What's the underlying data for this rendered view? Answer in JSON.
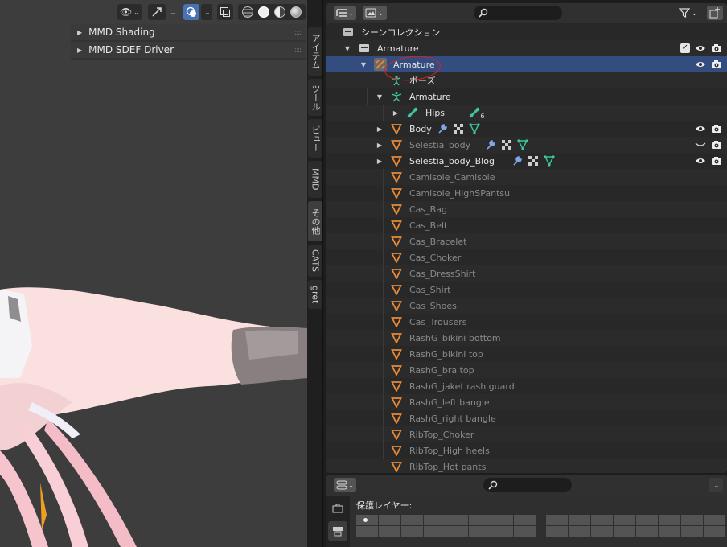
{
  "viewport": {
    "panels": [
      {
        "label": "MMD Shading"
      },
      {
        "label": "MMD SDEF Driver"
      }
    ]
  },
  "sidebar_tabs": [
    {
      "label": "アイテム",
      "active": false
    },
    {
      "label": "ツール",
      "active": false
    },
    {
      "label": "ビュー",
      "active": false
    },
    {
      "label": "MMD",
      "active": false
    },
    {
      "label": "その他",
      "active": true
    },
    {
      "label": "CATS",
      "active": false
    },
    {
      "label": "gret",
      "active": false
    }
  ],
  "outliner": {
    "search": {
      "value": "",
      "placeholder": ""
    },
    "rows": [
      {
        "label": "シーンコレクション",
        "icon": "scene-collection-icon",
        "expander": "",
        "dim": false
      },
      {
        "label": "Armature",
        "icon": "collection-icon",
        "expander": "▼",
        "dim": false,
        "checked": true
      },
      {
        "label": "Armature",
        "icon": "armature-object-icon",
        "expander": "▼",
        "dim": false,
        "selected": true
      },
      {
        "label": "ポーズ",
        "icon": "pose-icon",
        "expander": "",
        "dim": false
      },
      {
        "label": "Armature",
        "icon": "armature-data-icon",
        "expander": "▼",
        "dim": false
      },
      {
        "label": "Hips",
        "icon": "bone-icon",
        "expander": "▶",
        "dim": false,
        "badge": "6"
      },
      {
        "label": "Body",
        "icon": "mesh-icon",
        "expander": "▶",
        "dim": false,
        "mods": true
      },
      {
        "label": "Selestia_body",
        "icon": "mesh-icon",
        "expander": "▶",
        "dim": true,
        "mods": true,
        "hidden": true
      },
      {
        "label": "Selestia_body_Blog",
        "icon": "mesh-icon",
        "expander": "▶",
        "dim": false,
        "mods": true
      },
      {
        "label": "Camisole_Camisole",
        "icon": "mesh-icon",
        "expander": "",
        "dim": true
      },
      {
        "label": "Camisole_HighSPantsu",
        "icon": "mesh-icon",
        "expander": "",
        "dim": true
      },
      {
        "label": "Cas_Bag",
        "icon": "mesh-icon",
        "expander": "",
        "dim": true
      },
      {
        "label": "Cas_Belt",
        "icon": "mesh-icon",
        "expander": "",
        "dim": true
      },
      {
        "label": "Cas_Bracelet",
        "icon": "mesh-icon",
        "expander": "",
        "dim": true
      },
      {
        "label": "Cas_Choker",
        "icon": "mesh-icon",
        "expander": "",
        "dim": true
      },
      {
        "label": "Cas_DressShirt",
        "icon": "mesh-icon",
        "expander": "",
        "dim": true
      },
      {
        "label": "Cas_Shirt",
        "icon": "mesh-icon",
        "expander": "",
        "dim": true
      },
      {
        "label": "Cas_Shoes",
        "icon": "mesh-icon",
        "expander": "",
        "dim": true
      },
      {
        "label": "Cas_Trousers",
        "icon": "mesh-icon",
        "expander": "",
        "dim": true
      },
      {
        "label": "RashG_bikini bottom",
        "icon": "mesh-icon",
        "expander": "",
        "dim": true
      },
      {
        "label": "RashG_bikini top",
        "icon": "mesh-icon",
        "expander": "",
        "dim": true
      },
      {
        "label": "RashG_bra top",
        "icon": "mesh-icon",
        "expander": "",
        "dim": true
      },
      {
        "label": "RashG_jaket rash guard",
        "icon": "mesh-icon",
        "expander": "",
        "dim": true
      },
      {
        "label": "RashG_left bangle",
        "icon": "mesh-icon",
        "expander": "",
        "dim": true
      },
      {
        "label": "RashG_right bangle",
        "icon": "mesh-icon",
        "expander": "",
        "dim": true
      },
      {
        "label": "RibTop_Choker",
        "icon": "mesh-icon",
        "expander": "",
        "dim": true
      },
      {
        "label": "RibTop_High heels",
        "icon": "mesh-icon",
        "expander": "",
        "dim": true
      },
      {
        "label": "RibTop_Hot pants",
        "icon": "mesh-icon",
        "expander": "",
        "dim": true
      }
    ]
  },
  "properties": {
    "search": {
      "value": "",
      "placeholder": ""
    },
    "protected_layers_label": "保護レイヤー:",
    "layers_on": 1
  },
  "colors": {
    "selection": "#334d80",
    "accent": "#4772b3",
    "annotation": "#e02020",
    "mesh_icon": "#e8893a",
    "armature_icon": "#3dc6a0"
  }
}
